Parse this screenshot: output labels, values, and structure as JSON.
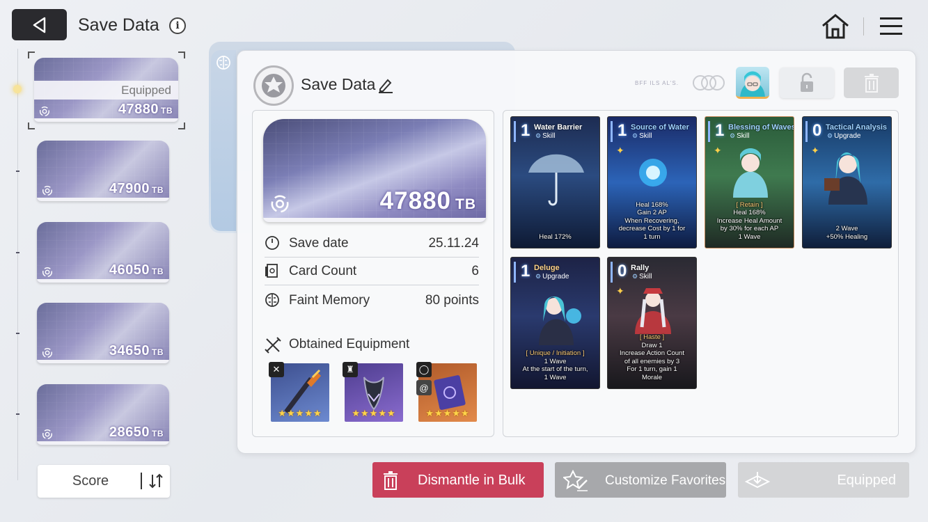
{
  "header": {
    "title": "Save Data",
    "info_glyph": "i"
  },
  "save_list": {
    "equipped_label": "Equipped",
    "unit": "TB",
    "items": [
      {
        "score": "47880",
        "selected": true
      },
      {
        "score": "47900"
      },
      {
        "score": "46050"
      },
      {
        "score": "34650"
      },
      {
        "score": "28650"
      }
    ]
  },
  "sort": {
    "label": "Score"
  },
  "detail": {
    "title": "Save Data",
    "tiny_label": "BFF ILS AL'S.",
    "big_card": {
      "score": "47880",
      "unit": "TB"
    },
    "stats": [
      {
        "label": "Save date",
        "value": "25.11.24"
      },
      {
        "label": "Card Count",
        "value": "6"
      },
      {
        "label": "Faint Memory",
        "value": "80 points"
      }
    ],
    "equipment_title": "Obtained Equipment",
    "equipment": [
      {
        "stars": "★★★★★",
        "icon": "sword-icon"
      },
      {
        "stars": "★★★★★",
        "icon": "armor-icon"
      },
      {
        "stars": "★★★★★",
        "icon": "ring-icon"
      }
    ]
  },
  "cards": [
    {
      "cost": "1",
      "name": "Water Barrier",
      "type": "Skill",
      "desc": [
        "Heal 172%"
      ]
    },
    {
      "cost": "1",
      "name": "Source of Water",
      "type": "Skill",
      "desc": [
        "Heal 168%",
        "Gain 2 AP",
        "When Recovering,",
        "decrease Cost by 1 for",
        "1 turn"
      ]
    },
    {
      "cost": "1",
      "name": "Blessing of Waves",
      "type": "Skill",
      "desc": [
        "[ Retain ]",
        "Heal 168%",
        "Increase Heal Amount",
        "by 30% for each AP",
        "1 Wave"
      ]
    },
    {
      "cost": "0",
      "name": "Tactical Analysis",
      "type": "Upgrade",
      "desc": [
        "2 Wave",
        "+50% Healing"
      ]
    },
    {
      "cost": "1",
      "name": "Deluge",
      "type": "Upgrade",
      "desc": [
        "[ Unique / Initiation ]",
        "1 Wave",
        "At the start of the turn,",
        "1 Wave"
      ]
    },
    {
      "cost": "0",
      "name": "Rally",
      "type": "Skill",
      "desc": [
        "[ Haste ]",
        "Draw 1",
        "Increase Action Count",
        "of all enemies by 3",
        "For 1 turn, gain 1",
        "Morale"
      ]
    }
  ],
  "buttons": {
    "dismantle": "Dismantle in Bulk",
    "favorites": "Customize Favorites",
    "equipped": "Equipped"
  },
  "colors": {
    "dismantle": "#c9405a",
    "score_purple": "#8f8bc2"
  }
}
